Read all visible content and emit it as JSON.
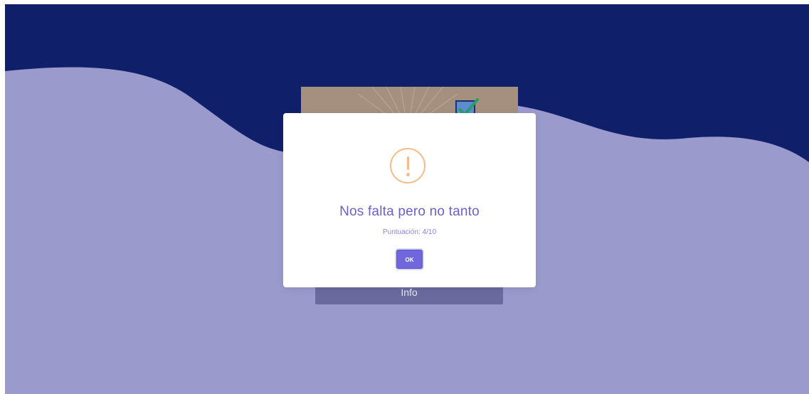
{
  "background": {
    "top_color": "#101f6a",
    "wave_color": "#9a9acc"
  },
  "card": {
    "image_icon": "checkbox-checked-icon",
    "info_label": "Info"
  },
  "modal": {
    "icon": "warning-icon",
    "icon_color": "#f8bb86",
    "title": "Nos falta pero no tanto",
    "text": "Puntuación: 4/10",
    "ok_label": "OK",
    "accent_color": "#7067dd"
  }
}
